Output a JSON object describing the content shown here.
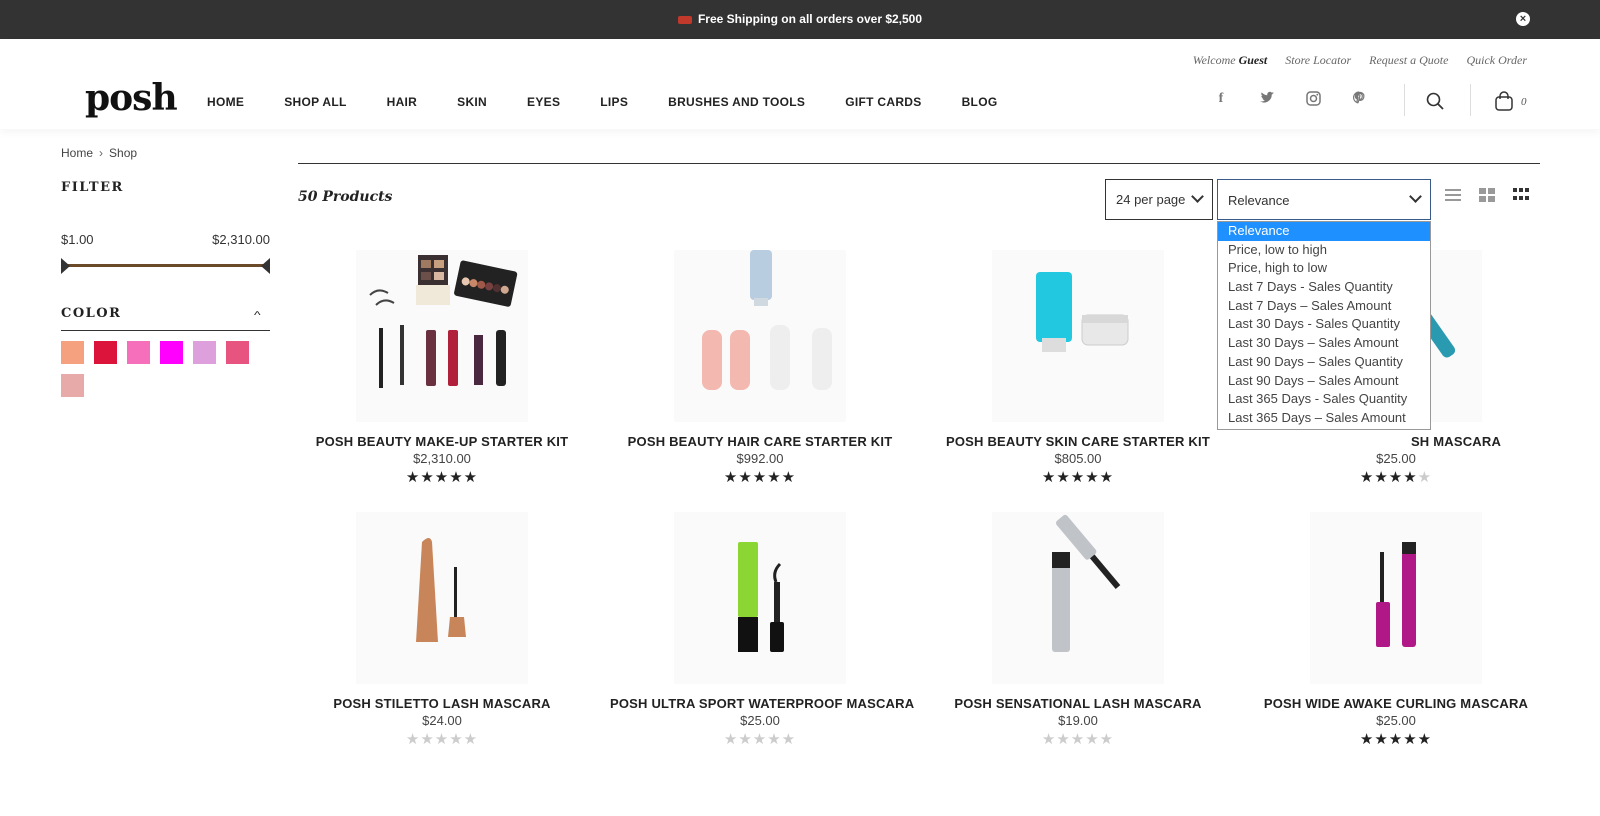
{
  "announcement": {
    "text": "Free Shipping on all orders over $2,500"
  },
  "header": {
    "top_links": {
      "welcome": "Welcome",
      "guest": "Guest",
      "store_locator": "Store Locator",
      "request_quote": "Request a Quote",
      "quick_order": "Quick Order"
    },
    "logo": "posh",
    "nav": [
      "HOME",
      "SHOP ALL",
      "HAIR",
      "SKIN",
      "EYES",
      "LIPS",
      "BRUSHES AND TOOLS",
      "GIFT CARDS",
      "BLOG"
    ],
    "social_icons": [
      "facebook-icon",
      "twitter-icon",
      "instagram-icon",
      "pinterest-icon"
    ],
    "cart_count": "0"
  },
  "breadcrumb": {
    "home": "Home",
    "sep": "›",
    "current": "Shop"
  },
  "sidebar": {
    "filter_title": "FILTER",
    "price_min": "$1.00",
    "price_max": "$2,310.00",
    "color_title": "COLOR",
    "colors": [
      "#f5a07e",
      "#dc143c",
      "#f56fbb",
      "#ff00ff",
      "#dda0dd",
      "#e75480",
      "#e8a9a9"
    ]
  },
  "toolbar": {
    "product_count": "50 Products",
    "per_page": "24 per page",
    "sort_selected": "Relevance",
    "sort_options": [
      "Relevance",
      "Price, low to high",
      "Price, high to low",
      "Last 7 Days - Sales Quantity",
      "Last 7 Days – Sales Amount",
      "Last 30 Days - Sales Quantity",
      "Last 30 Days – Sales Amount",
      "Last 90 Days – Sales Quantity",
      "Last 90 Days – Sales Amount",
      "Last 365 Days - Sales Quantity",
      "Last 365 Days – Sales Amount"
    ]
  },
  "products": [
    {
      "name": "POSH BEAUTY MAKE-UP STARTER KIT",
      "price": "$2,310.00",
      "rating": 5
    },
    {
      "name": "POSH BEAUTY HAIR CARE STARTER KIT",
      "price": "$992.00",
      "rating": 5
    },
    {
      "name": "POSH BEAUTY SKIN CARE STARTER KIT",
      "price": "$805.00",
      "rating": 5
    },
    {
      "name": "SH MASCARA",
      "price": "$25.00",
      "rating": 4
    },
    {
      "name": "POSH STILETTO LASH MASCARA",
      "price": "$24.00",
      "rating": 0
    },
    {
      "name": "POSH ULTRA SPORT WATERPROOF MASCARA",
      "price": "$25.00",
      "rating": 0
    },
    {
      "name": "POSH SENSATIONAL LASH MASCARA",
      "price": "$19.00",
      "rating": 0
    },
    {
      "name": "POSH WIDE AWAKE CURLING MASCARA",
      "price": "$25.00",
      "rating": 5
    }
  ]
}
